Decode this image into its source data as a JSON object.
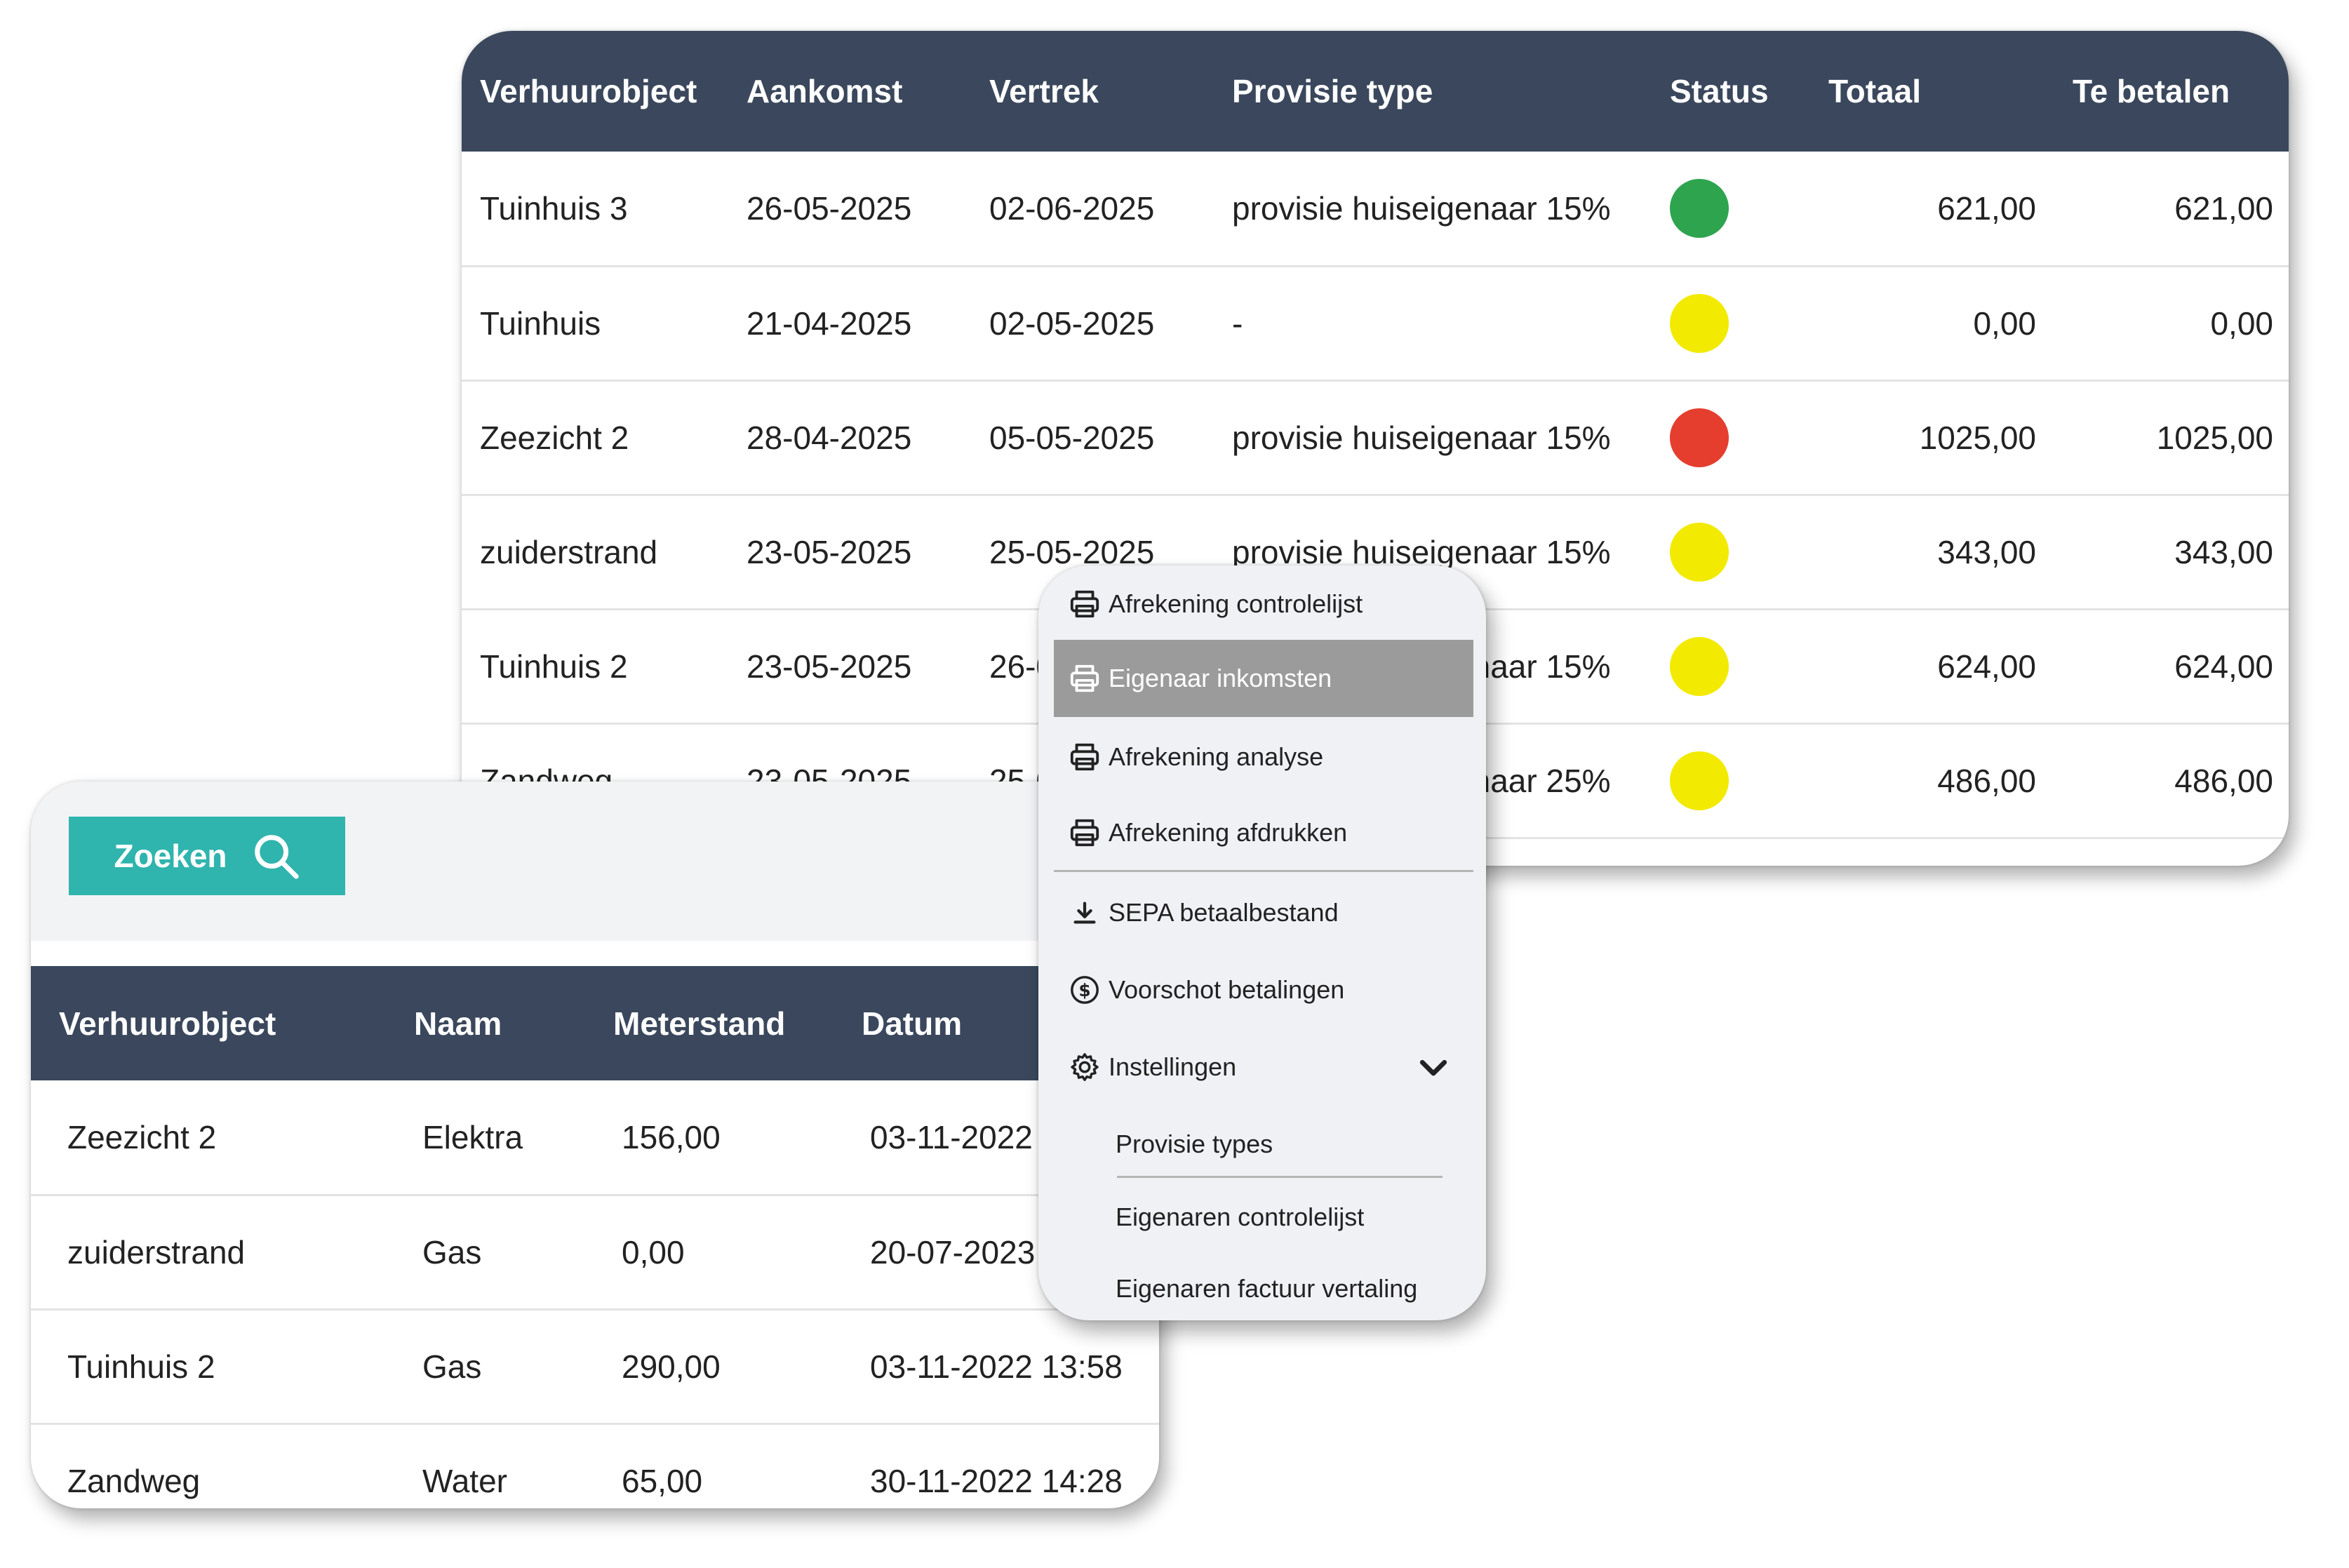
{
  "bookings": {
    "columns": [
      "Verhuurobject",
      "Aankomst",
      "Vertrek",
      "Provisie type",
      "Status",
      "Totaal",
      "Te betalen"
    ],
    "rows": [
      {
        "object": "Tuinhuis 3",
        "arrival": "26-05-2025",
        "departure": "02-06-2025",
        "commission": "provisie huiseigenaar 15%",
        "status": "green",
        "total": "621,00",
        "due": "621,00"
      },
      {
        "object": "Tuinhuis",
        "arrival": "21-04-2025",
        "departure": "02-05-2025",
        "commission": "-",
        "status": "yellow",
        "total": "0,00",
        "due": "0,00"
      },
      {
        "object": "Zeezicht 2",
        "arrival": "28-04-2025",
        "departure": "05-05-2025",
        "commission": "provisie huiseigenaar 15%",
        "status": "red",
        "total": "1025,00",
        "due": "1025,00"
      },
      {
        "object": "zuiderstrand",
        "arrival": "23-05-2025",
        "departure": "25-05-2025",
        "commission": "provisie huiseigenaar 15%",
        "status": "yellow",
        "total": "343,00",
        "due": "343,00"
      },
      {
        "object": "Tuinhuis 2",
        "arrival": "23-05-2025",
        "departure": "26-05-2025",
        "commission": "provisie huiseigenaar 15%",
        "status": "yellow",
        "total": "624,00",
        "due": "624,00"
      },
      {
        "object": "Zandweg",
        "arrival": "23-05-2025",
        "departure": "25-05-2025",
        "commission": "provisie huiseigenaar 25%",
        "status": "yellow",
        "total": "486,00",
        "due": "486,00"
      }
    ]
  },
  "status_colors": {
    "green": "#2fa44f",
    "yellow": "#f2ea00",
    "red": "#e53e2e"
  },
  "meters": {
    "search_label": "Zoeken",
    "columns": [
      "Verhuurobject",
      "Naam",
      "Meterstand",
      "Datum"
    ],
    "rows": [
      {
        "object": "Zeezicht 2",
        "name": "Elektra",
        "reading": "156,00",
        "date": "03-11-2022"
      },
      {
        "object": "zuiderstrand",
        "name": "Gas",
        "reading": "0,00",
        "date": "20-07-2023"
      },
      {
        "object": "Tuinhuis 2",
        "name": "Gas",
        "reading": "290,00",
        "date": "03-11-2022 13:58"
      },
      {
        "object": "Zandweg",
        "name": "Water",
        "reading": "65,00",
        "date": "30-11-2022 14:28"
      }
    ]
  },
  "menu": {
    "items": [
      {
        "label": "Afrekening controlelijst",
        "icon": "printer-icon"
      },
      {
        "label": "Eigenaar inkomsten",
        "icon": "printer-icon",
        "active": true
      },
      {
        "label": "Afrekening analyse",
        "icon": "printer-icon"
      },
      {
        "label": "Afrekening afdrukken",
        "icon": "printer-icon"
      },
      {
        "label": "SEPA betaalbestand",
        "icon": "download-icon"
      },
      {
        "label": "Voorschot betalingen",
        "icon": "dollar-circle-icon"
      },
      {
        "label": "Instellingen",
        "icon": "gear-icon"
      }
    ],
    "subitems": [
      {
        "label": "Provisie types"
      },
      {
        "label": "Eigenaren controlelijst"
      },
      {
        "label": "Eigenaren factuur vertaling"
      }
    ]
  }
}
